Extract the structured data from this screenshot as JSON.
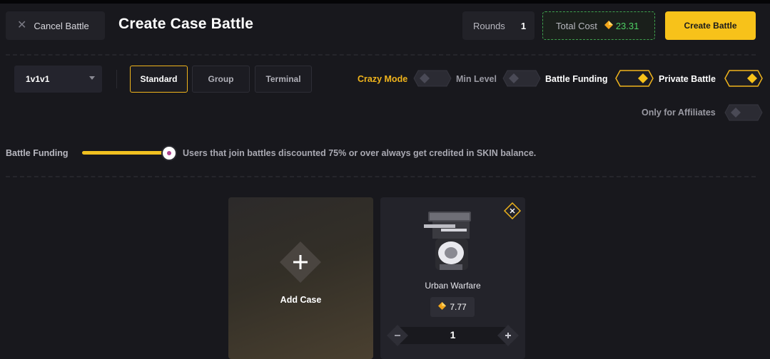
{
  "header": {
    "cancel_label": "Cancel Battle",
    "title": "Create Case Battle",
    "rounds_label": "Rounds",
    "rounds_value": "1",
    "total_cost_label": "Total Cost",
    "total_cost_value": "23.31",
    "create_label": "Create Battle"
  },
  "modes": {
    "selected_format": "1v1v1",
    "types": [
      "Standard",
      "Group",
      "Terminal"
    ],
    "active_type": "Standard"
  },
  "options": {
    "crazy_mode": {
      "label": "Crazy Mode",
      "on": false
    },
    "min_level": {
      "label": "Min Level",
      "on": false
    },
    "battle_funding": {
      "label": "Battle Funding",
      "on": true
    },
    "private_battle": {
      "label": "Private Battle",
      "on": true
    },
    "only_affiliates": {
      "label": "Only for Affiliates",
      "on": false
    }
  },
  "funding": {
    "label": "Battle Funding",
    "slider_value": 1.0,
    "note": "Users that join battles discounted 75% or over always get credited in SKIN balance."
  },
  "add_card": {
    "label": "Add Case"
  },
  "cases": [
    {
      "name": "Urban Warfare",
      "price": "7.77",
      "quantity": "1"
    }
  ],
  "colors": {
    "accent": "#f7c21a",
    "background": "#18181d",
    "positive": "#4ed164"
  }
}
